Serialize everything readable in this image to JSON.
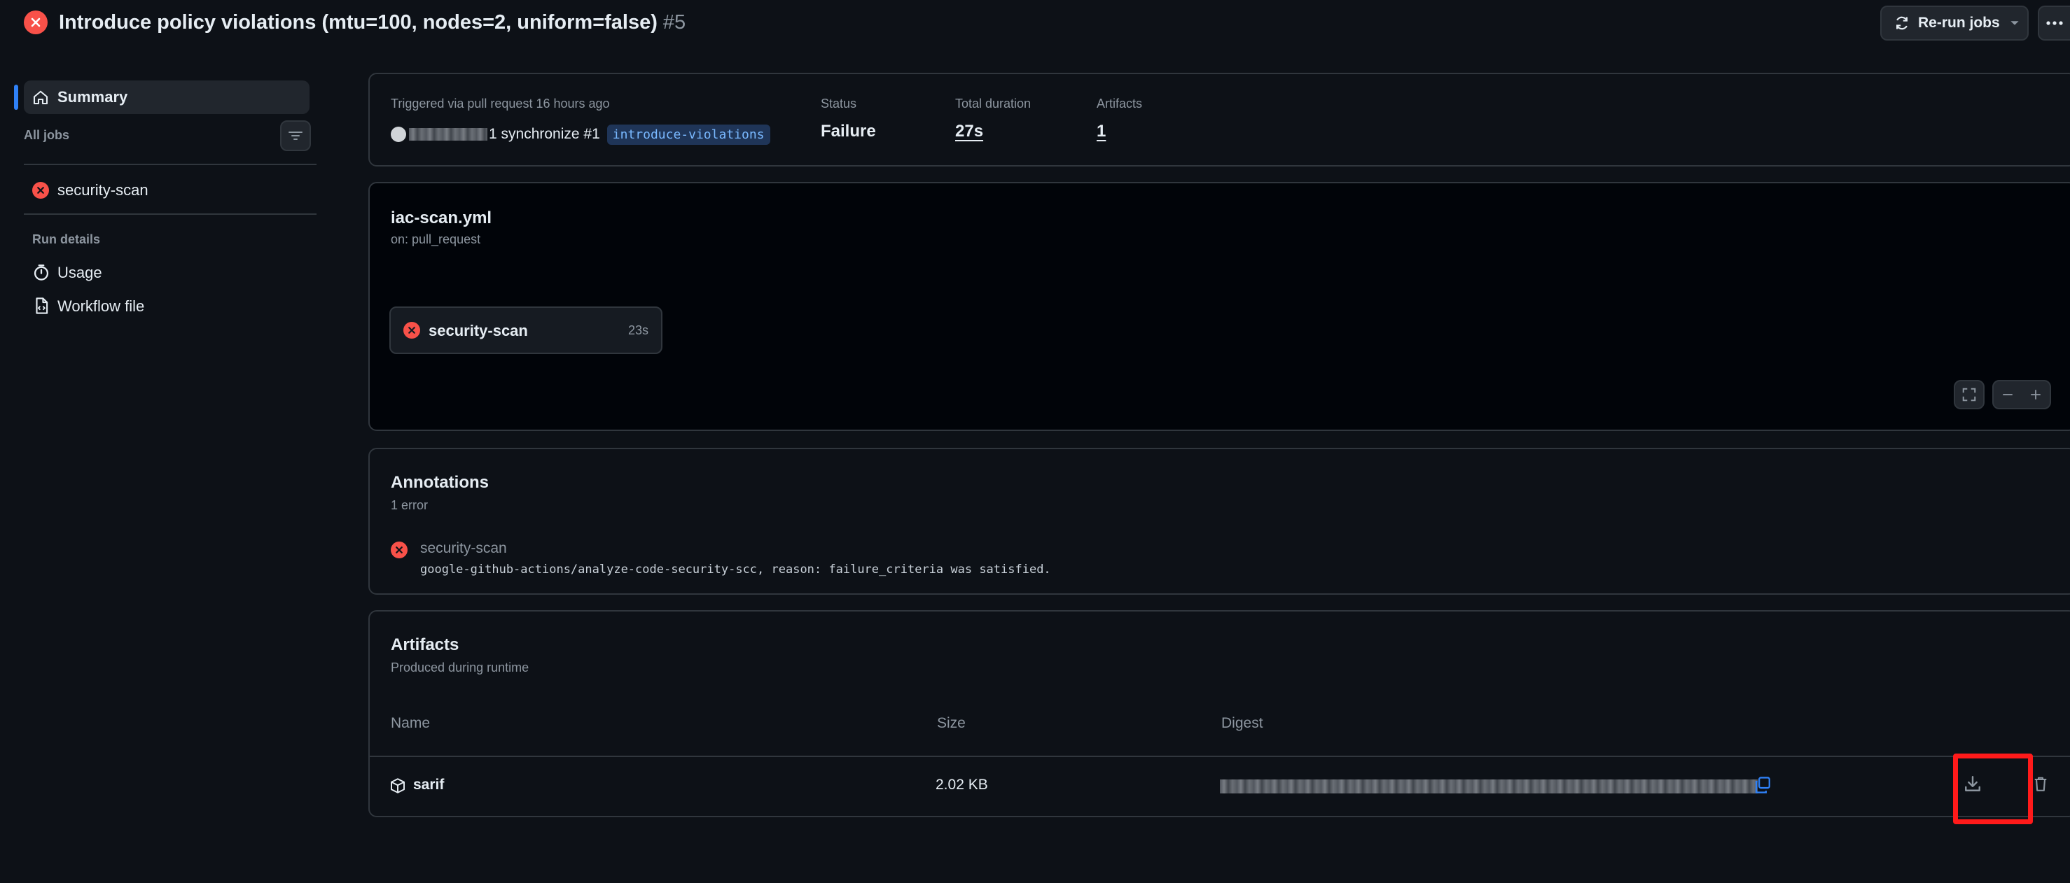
{
  "header": {
    "title": "Introduce policy violations (mtu=100, nodes=2, uniform=false)",
    "run_number": "#5",
    "rerun_label": "Re-run jobs",
    "status_icon": "x-circle-icon"
  },
  "sidebar": {
    "summary_label": "Summary",
    "all_jobs_label": "All jobs",
    "jobs": [
      {
        "label": "security-scan",
        "status": "failure"
      }
    ],
    "run_details_label": "Run details",
    "details": [
      {
        "label": "Usage",
        "icon": "stopwatch-icon"
      },
      {
        "label": "Workflow file",
        "icon": "file-code-icon"
      }
    ]
  },
  "summary": {
    "trigger_text": "Triggered via pull request 16 hours ago",
    "actor_suffix": "1 synchronize #1",
    "branch": "introduce-violations",
    "status_label": "Status",
    "status_value": "Failure",
    "duration_label": "Total duration",
    "duration_value": "27s",
    "artifacts_label": "Artifacts",
    "artifacts_value": "1"
  },
  "workflow": {
    "file": "iac-scan.yml",
    "trigger": "on: pull_request",
    "job": {
      "name": "security-scan",
      "duration": "23s"
    }
  },
  "annotations": {
    "title": "Annotations",
    "count": "1 error",
    "items": [
      {
        "job": "security-scan",
        "message": "google-github-actions/analyze-code-security-scc, reason: failure_criteria was satisfied."
      }
    ]
  },
  "artifacts": {
    "title": "Artifacts",
    "subtitle": "Produced during runtime",
    "columns": [
      "Name",
      "Size",
      "Digest"
    ],
    "rows": [
      {
        "name": "sarif",
        "size": "2.02 KB"
      }
    ]
  },
  "colors": {
    "background": "#0d1117",
    "failure": "#f85149",
    "accent": "#2f81f7",
    "highlight": "#ff1a1a"
  }
}
